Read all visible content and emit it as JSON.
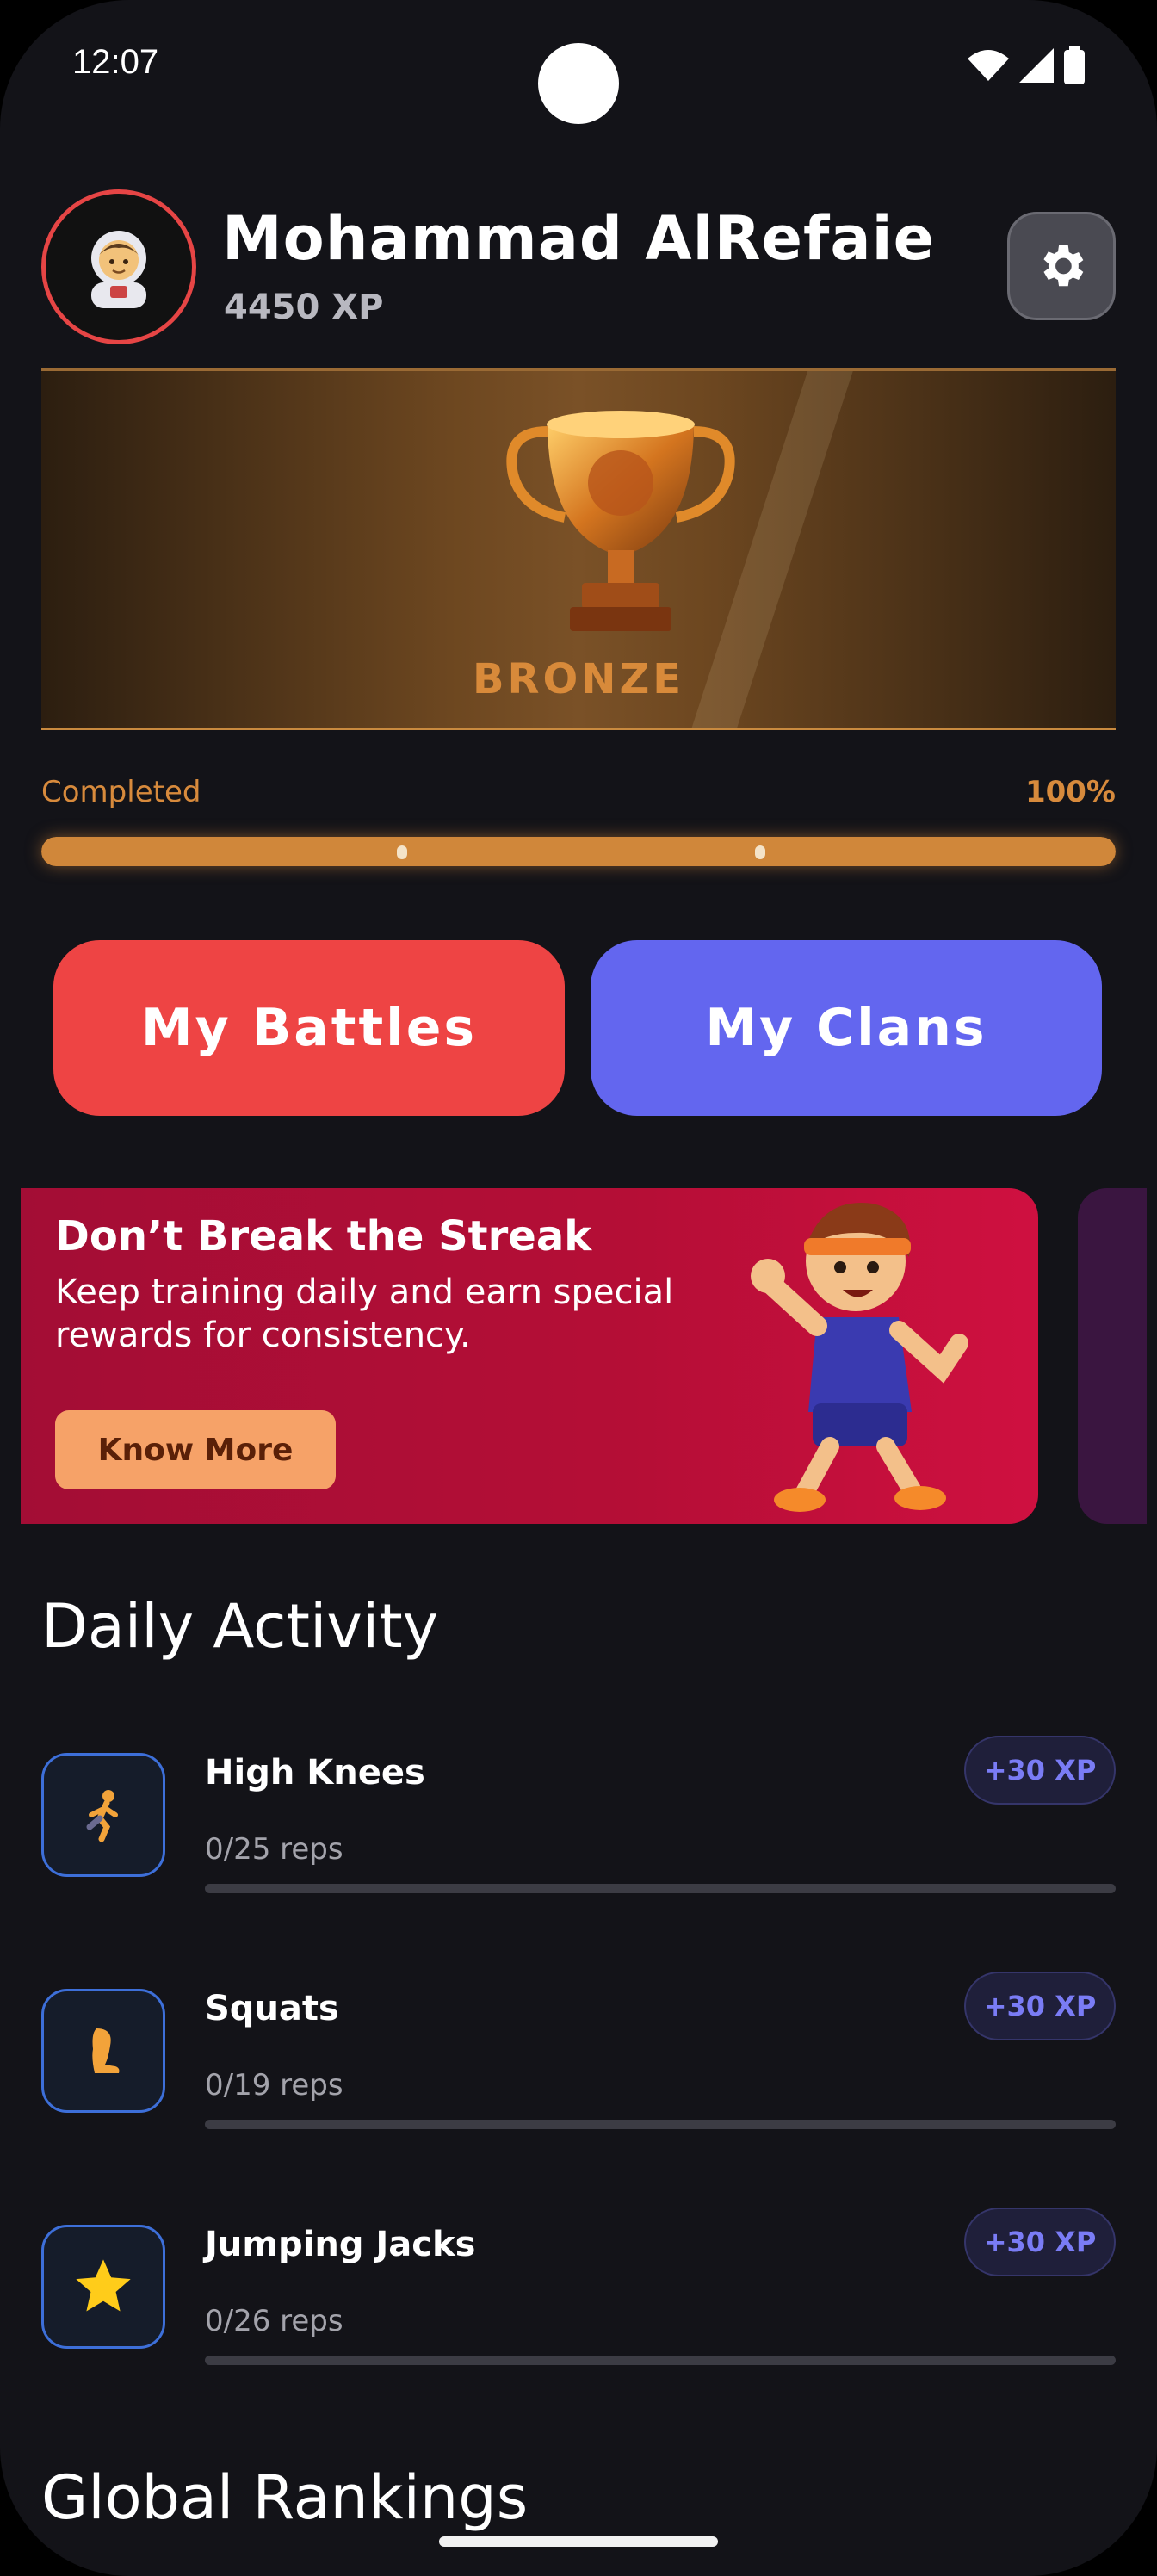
{
  "status_bar": {
    "time": "12:07"
  },
  "profile": {
    "name": "Mohammad AlRefaie",
    "xp": "4450 XP",
    "avatar_icon": "astronaut-icon"
  },
  "rank": {
    "label": "BRONZE",
    "progress_label": "Completed",
    "progress_value": "100%",
    "progress_fraction": 1.0
  },
  "buttons": {
    "battles": "My Battles",
    "clans": "My Clans"
  },
  "promo": {
    "title": "Don’t Break the Streak",
    "text": "Keep training daily and earn special rewards for consistency.",
    "button": "Know More"
  },
  "daily": {
    "title": "Daily Activity",
    "items": [
      {
        "name": "High Knees",
        "reps": "0/25 reps",
        "xp": "+30 XP",
        "icon": "runner-icon",
        "progress": 0
      },
      {
        "name": "Squats",
        "reps": "0/19 reps",
        "xp": "+30 XP",
        "icon": "leg-icon",
        "progress": 0
      },
      {
        "name": "Jumping Jacks",
        "reps": "0/26 reps",
        "xp": "+30 XP",
        "icon": "star-icon",
        "progress": 0
      }
    ]
  },
  "rankings": {
    "title": "Global Rankings"
  },
  "colors": {
    "accent_red": "#ee4444",
    "accent_indigo": "#6366ef",
    "bronze": "#d0873a",
    "background": "#131318"
  }
}
